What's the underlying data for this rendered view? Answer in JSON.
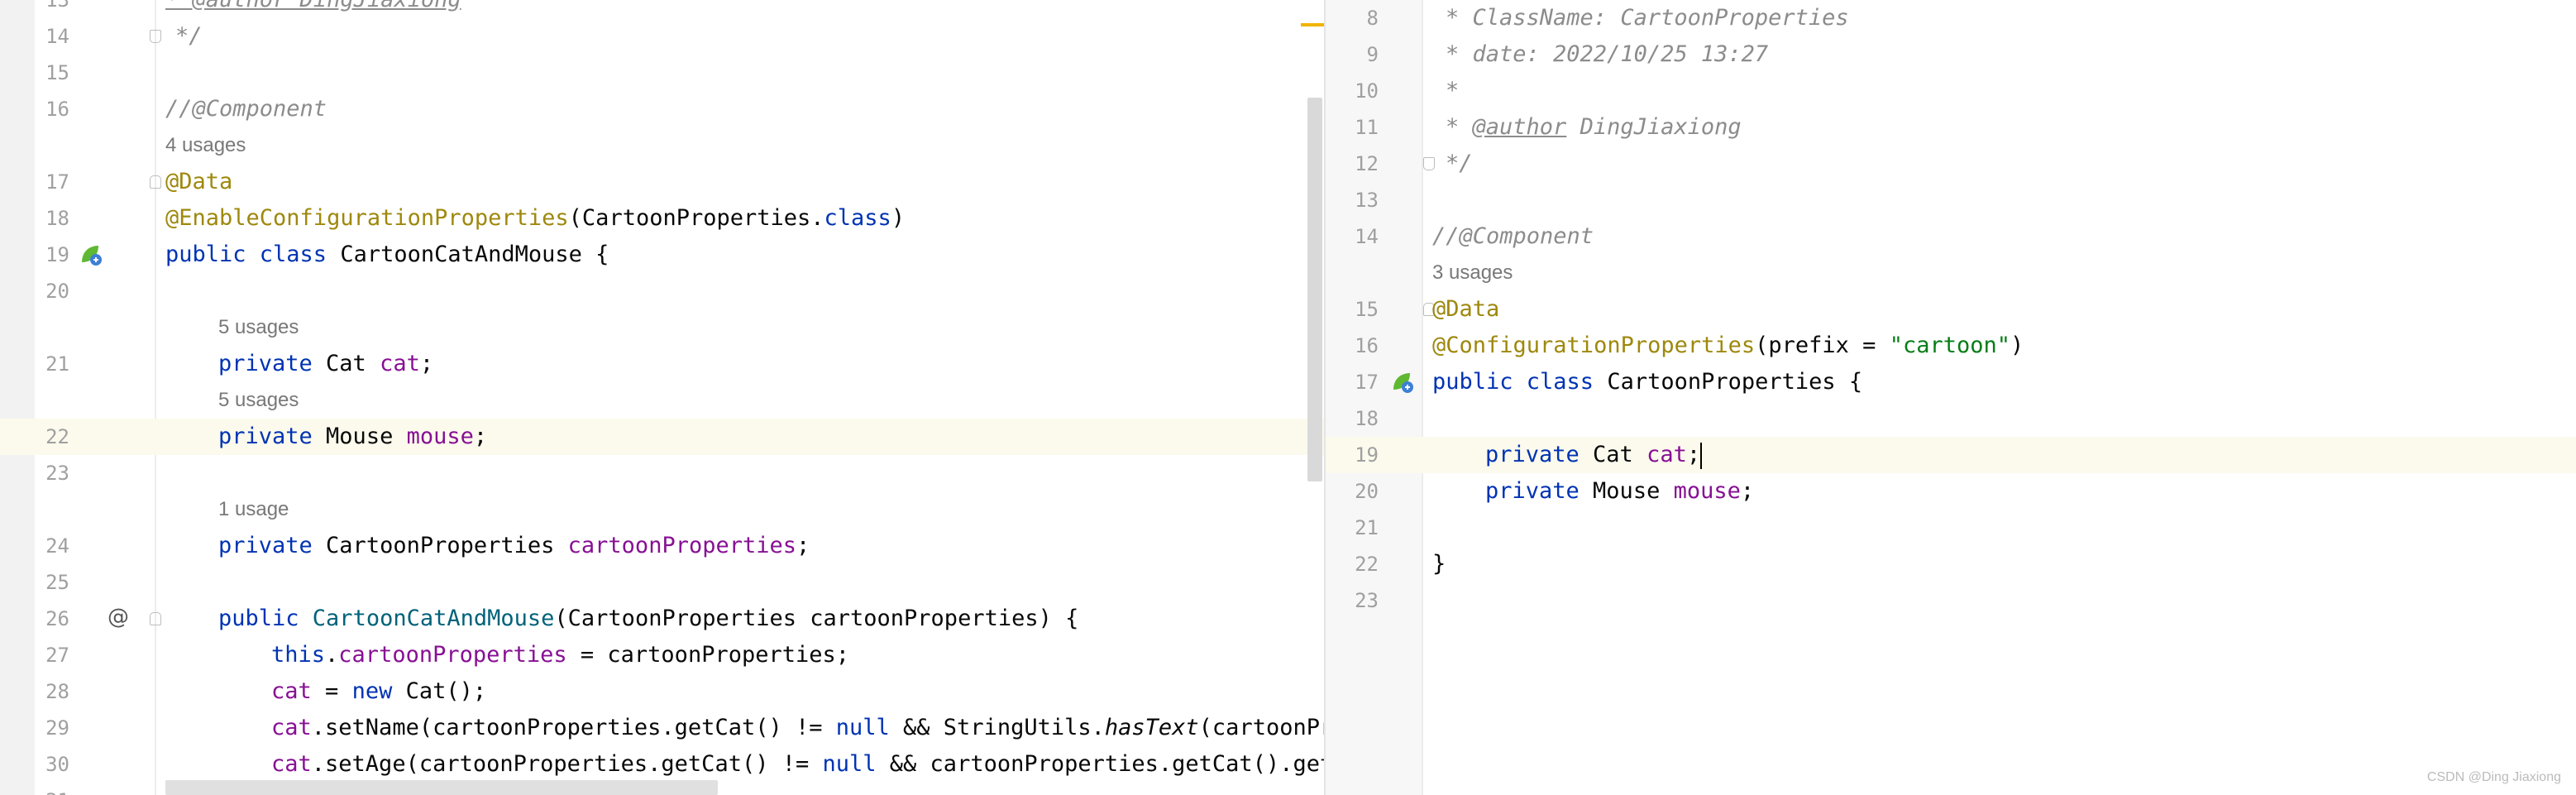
{
  "left_editor": {
    "line_numbers": [
      "13",
      "14",
      "15",
      "16",
      "17",
      "18",
      "19",
      "20",
      "21",
      "22",
      "23",
      "24",
      "25",
      "26",
      "27",
      "28",
      "29",
      "30",
      "31"
    ],
    "inlay_hints": [
      "4 usages",
      "5 usages",
      "5 usages",
      "1 usage"
    ],
    "lines": {
      "l13": "* @author DingJiaxiong",
      "l14": "*/",
      "l16": "//@Component",
      "l17": "@Data",
      "l18_ann": "@EnableConfigurationProperties",
      "l18_rest": "(CartoonProperties.",
      "l18_class": "class",
      "l18_end": ")",
      "l19_kw": "public class ",
      "l19_rest": "CartoonCatAndMouse {",
      "l21_kw": "private ",
      "l21_type": "Cat ",
      "l21_field": "cat",
      "l21_end": ";",
      "l22_kw": "private ",
      "l22_type": "Mouse ",
      "l22_field": "mouse",
      "l22_end": ";",
      "l24_kw": "private ",
      "l24_type": "CartoonProperties ",
      "l24_field": "cartoonProperties",
      "l24_end": ";",
      "l26_kw": "public ",
      "l26_fn": "CartoonCatAndMouse",
      "l26_rest": "(CartoonProperties cartoonProperties) {",
      "l27_this": "this",
      "l27_dot": ".",
      "l27_field": "cartoonProperties",
      "l27_rest": " = cartoonProperties;",
      "l28_field": "cat",
      "l28_mid": " = ",
      "l28_new": "new ",
      "l28_rest": "Cat();",
      "l29_field": "cat",
      "l29_a": ".setName(cartoonProperties.getCat() != ",
      "l29_null": "null",
      "l29_b": " && StringUtils.",
      "l29_it": "hasText",
      "l29_c": "(cartoonPro",
      "l30_field": "cat",
      "l30_a": ".setAge(cartoonProperties.getCat() != ",
      "l30_null": "null",
      "l30_b": " && cartoonProperties.getCat().getA"
    }
  },
  "right_editor": {
    "line_numbers": [
      "8",
      "9",
      "10",
      "11",
      "12",
      "13",
      "14",
      "15",
      "16",
      "17",
      "18",
      "19",
      "20",
      "21",
      "22",
      "23"
    ],
    "inlay_hints": [
      "3 usages"
    ],
    "lines": {
      "r8": "* ClassName: CartoonProperties",
      "r9": "* date: 2022/10/25 13:27",
      "r10": "*",
      "r11_tag": "@author",
      "r11_rest": " DingJiaxiong",
      "r12": "*/",
      "r14": "//@Component",
      "r15": "@Data",
      "r16_ann": "@ConfigurationProperties",
      "r16_a": "(prefix = ",
      "r16_str": "\"cartoon\"",
      "r16_end": ")",
      "r17_kw": "public class ",
      "r17_rest": "CartoonProperties {",
      "r19_kw": "private ",
      "r19_type": "Cat ",
      "r19_field": "cat",
      "r19_end": ";",
      "r20_kw": "private ",
      "r20_type": "Mouse ",
      "r20_field": "mouse",
      "r20_end": ";",
      "r22": "}"
    }
  },
  "colors": {
    "keyword": "#0033b3",
    "annotation": "#9e880d",
    "field": "#871094",
    "string": "#067d17",
    "comment": "#8c8c8c",
    "method": "#00627a",
    "current_line": "#fcfaed"
  },
  "icons": [
    "fold-marker-icon",
    "spring-bean-icon",
    "autowired-at-icon"
  ],
  "watermark": "CSDN @Ding Jiaxiong"
}
